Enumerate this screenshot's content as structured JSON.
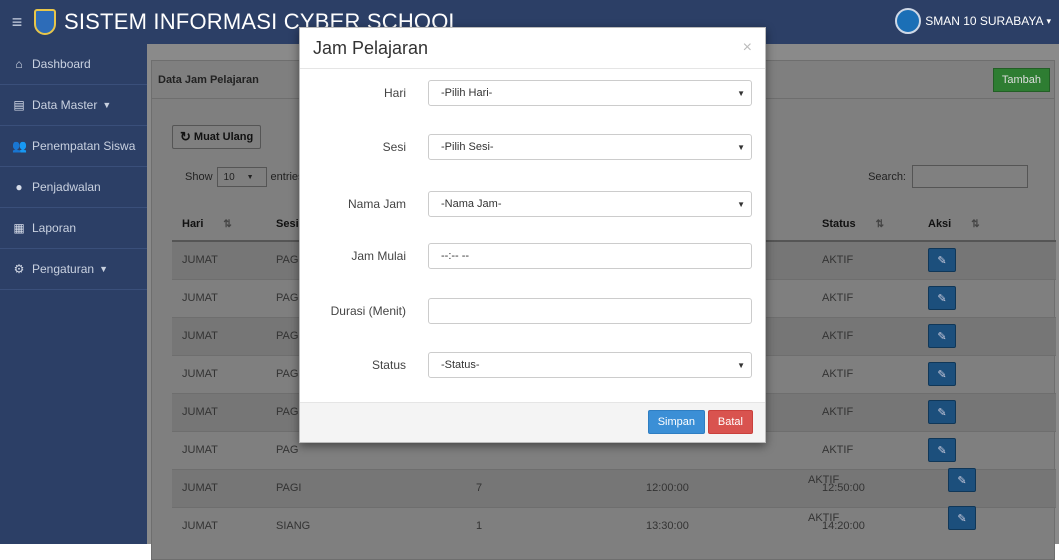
{
  "header": {
    "menu_icon": "hamburger-icon",
    "title": "SISTEM INFORMASI CYBER SCHOOL",
    "user": "SMAN 10 SURABAYA",
    "user_caret": "▾"
  },
  "sidebar": {
    "items": [
      {
        "label": "Dashboard",
        "icon": "home-icon"
      },
      {
        "label": "Data Master",
        "icon": "list-icon",
        "caret": "▼"
      },
      {
        "label": "Penempatan Siswa",
        "icon": "users-icon"
      },
      {
        "label": "Penjadwalan",
        "icon": "circle-icon"
      },
      {
        "label": "Laporan",
        "icon": "report-icon"
      },
      {
        "label": "Pengaturan",
        "icon": "gear-icon",
        "caret": "▼"
      }
    ]
  },
  "panel": {
    "title": "Data Jam Pelajaran",
    "add_button": "Tambah",
    "reload_button": "Muat Ulang",
    "show_label": "Show",
    "page_size": "10",
    "entries_label": "entries",
    "search_label": "Search:"
  },
  "table": {
    "headers": [
      "Hari",
      "Sesi",
      "Status",
      "Aksi"
    ],
    "rows": [
      {
        "hari": "JUMAT",
        "sesi": "PAG",
        "no": "",
        "mulai": "",
        "selesai": "",
        "status": "AKTIF"
      },
      {
        "hari": "JUMAT",
        "sesi": "PAG",
        "no": "",
        "mulai": "",
        "selesai": "",
        "status": "AKTIF"
      },
      {
        "hari": "JUMAT",
        "sesi": "PAG",
        "no": "",
        "mulai": "",
        "selesai": "",
        "status": "AKTIF"
      },
      {
        "hari": "JUMAT",
        "sesi": "PAG",
        "no": "",
        "mulai": "",
        "selesai": "",
        "status": "AKTIF"
      },
      {
        "hari": "JUMAT",
        "sesi": "PAG",
        "no": "",
        "mulai": "",
        "selesai": "",
        "status": "AKTIF"
      },
      {
        "hari": "JUMAT",
        "sesi": "PAG",
        "no": "",
        "mulai": "",
        "selesai": "",
        "status": "AKTIF"
      },
      {
        "hari": "JUMAT",
        "sesi": "PAGI",
        "no": "7",
        "mulai": "12:00:00",
        "selesai": "12:50:00",
        "status": "AKTIF"
      },
      {
        "hari": "JUMAT",
        "sesi": "SIANG",
        "no": "1",
        "mulai": "13:30:00",
        "selesai": "14:20:00",
        "status": "AKTIF"
      }
    ]
  },
  "modal": {
    "title": "Jam Pelajaran",
    "close": "×",
    "fields": {
      "hari": {
        "label": "Hari",
        "value": "-Pilih Hari-"
      },
      "sesi": {
        "label": "Sesi",
        "value": "-Pilih Sesi-"
      },
      "nama_jam": {
        "label": "Nama Jam",
        "value": "-Nama Jam-"
      },
      "jam_mulai": {
        "label": "Jam Mulai",
        "value": "--:-- --"
      },
      "durasi": {
        "label": "Durasi (Menit)",
        "value": ""
      },
      "status": {
        "label": "Status",
        "value": "-Status-"
      }
    },
    "save_button": "Simpan",
    "cancel_button": "Batal"
  },
  "colors": {
    "topbar": "#2c3f66",
    "add_button": "#2e7d32",
    "save_button": "#3b8fd6",
    "cancel_button": "#d9534f"
  }
}
